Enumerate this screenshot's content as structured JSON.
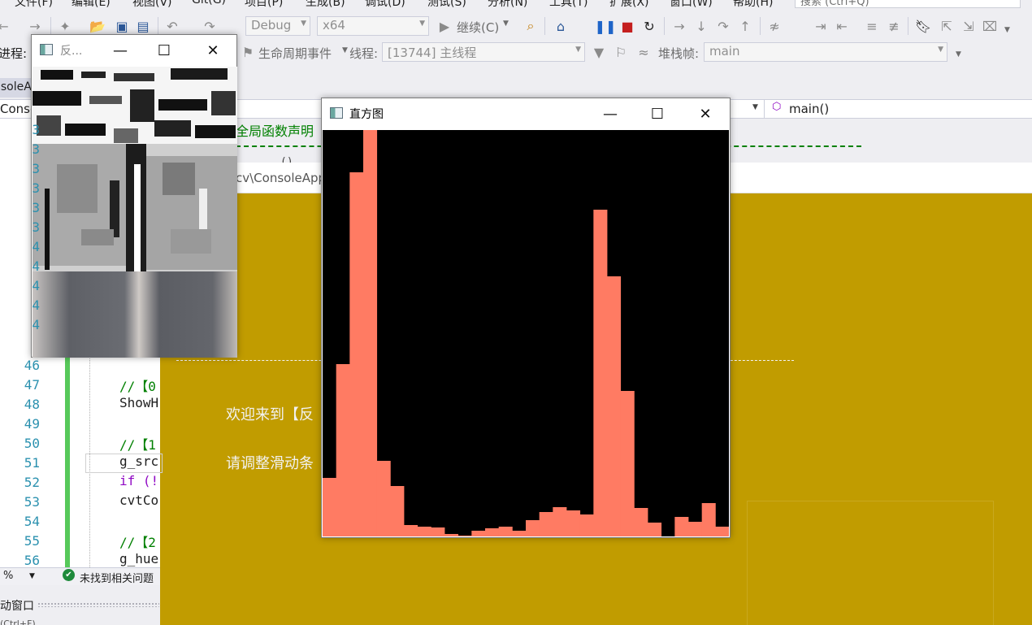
{
  "menu": [
    "文件(F)",
    "编辑(E)",
    "视图(V)",
    "Git(G)",
    "项目(P)",
    "生成(B)",
    "调试(D)",
    "测试(S)",
    "分析(N)",
    "工具(T)",
    "扩展(X)",
    "窗口(W)",
    "帮助(H)"
  ],
  "search": {
    "placeholder": "搜索 (Ctrl+Q)"
  },
  "toolbar": {
    "config": "Debug",
    "platform": "x64",
    "continue_label": "继续(C)",
    "process_label": "进程:",
    "lifecycle_label": "生命周期事件",
    "thread_label": "线程:",
    "thread_value": "[13744] 主线程",
    "stackframe_label": "堆栈帧:",
    "stackframe_value": "main"
  },
  "tab": {
    "label": "nsoleA"
  },
  "navbar": {
    "left": "Conso",
    "function": "main()"
  },
  "editor": {
    "line_numbers": [
      "3",
      "3",
      "3",
      "3",
      "3",
      "3",
      "4",
      "4",
      "4",
      "4",
      "4",
      "46",
      "47",
      "48",
      "49",
      "50",
      "51",
      "52",
      "53",
      "54",
      "55",
      "56"
    ],
    "code": [
      {
        "text": "//【0",
        "color": "#008000"
      },
      {
        "text": "ShowH",
        "color": "#1e1e1e"
      },
      {
        "text": "",
        "color": "#1e1e1e"
      },
      {
        "text": "//【1",
        "color": "#008000"
      },
      {
        "text": "g_src",
        "color": "#1e1e1e"
      },
      {
        "text": "if (!",
        "color": "#8f08c4"
      },
      {
        "text": "cvtCo",
        "color": "#1e1e1e"
      },
      {
        "text": "",
        "color": "#1e1e1e"
      },
      {
        "text": "//【2",
        "color": "#008000"
      },
      {
        "text": "g_hue",
        "color": "#1e1e1e"
      }
    ],
    "comment_fragment": "全局函数声明",
    "code_fragment": "()"
  },
  "status": {
    "zoom": "%",
    "issues": "未找到相关问题"
  },
  "bottom": {
    "panel_label": "动窗口",
    "next_label": "(Ctrl+F)"
  },
  "console": {
    "title_fragment": "cv\\ConsoleApp",
    "line1": "欢迎来到【反",
    "line2": "请调整滑动条",
    "bg_color": "#c19c00"
  },
  "proj_window": {
    "title": "反..."
  },
  "hist_window": {
    "title": "直方图",
    "bar_color": "#ff7b63",
    "background": "#000000"
  },
  "chart_data": {
    "type": "bar",
    "title": "",
    "xlabel": "",
    "ylabel": "",
    "bins": 30,
    "values": [
      72,
      212,
      448,
      500,
      93,
      62,
      14,
      12,
      11,
      3,
      1,
      7,
      10,
      12,
      7,
      20,
      30,
      36,
      32,
      27,
      402,
      320,
      179,
      35,
      17,
      0,
      24,
      18,
      41,
      12
    ],
    "ylim": [
      0,
      500
    ]
  }
}
